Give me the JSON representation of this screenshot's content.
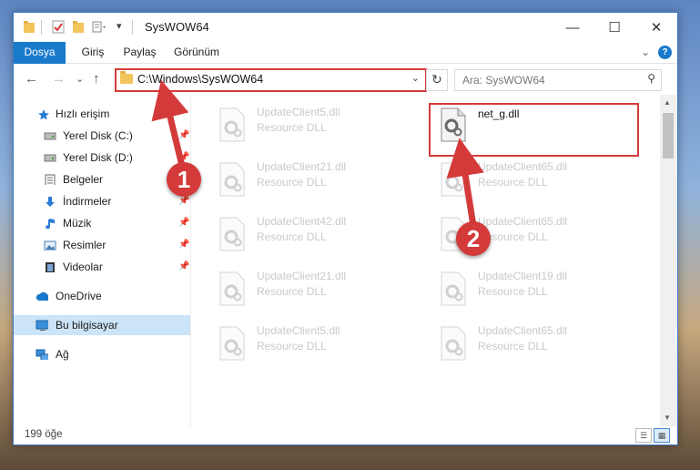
{
  "window": {
    "title": "SysWOW64",
    "controls": {
      "minimize": "—",
      "maximize": "☐",
      "close": "✕"
    }
  },
  "ribbon": {
    "tabs": [
      "Dosya",
      "Giriş",
      "Paylaş",
      "Görünüm"
    ],
    "expand_glyph": "⌄",
    "help_glyph": "?"
  },
  "navigation": {
    "back": "←",
    "forward": "→",
    "recent": "⌄",
    "up": "↑",
    "address_path": "C:\\Windows\\SysWOW64",
    "address_dropdown": "⌄",
    "refresh": "↻",
    "search_placeholder": "Ara: SysWOW64",
    "search_icon": "⚲"
  },
  "sidebar": {
    "items": [
      {
        "label": "Hızlı erişim",
        "icon": "star-icon",
        "pinned": false
      },
      {
        "label": "Yerel Disk (C:)",
        "icon": "drive-icon",
        "pinned": true
      },
      {
        "label": "Yerel Disk (D:)",
        "icon": "drive-icon",
        "pinned": true
      },
      {
        "label": "Belgeler",
        "icon": "documents-icon",
        "pinned": true
      },
      {
        "label": "İndirmeler",
        "icon": "download-icon",
        "pinned": true
      },
      {
        "label": "Müzik",
        "icon": "music-icon",
        "pinned": true
      },
      {
        "label": "Resimler",
        "icon": "pictures-icon",
        "pinned": true
      },
      {
        "label": "Videolar",
        "icon": "video-icon",
        "pinned": true
      },
      {
        "label": "OneDrive",
        "icon": "cloud-icon",
        "pinned": false
      },
      {
        "label": "Bu bilgisayar",
        "icon": "computer-icon",
        "pinned": false,
        "selected": true
      },
      {
        "label": "Ağ",
        "icon": "network-icon",
        "pinned": false
      }
    ]
  },
  "files": {
    "left_column": [
      {
        "name": "UpdateClient5.dll",
        "type": "Resource DLL"
      },
      {
        "name": "UpdateClient21.dll",
        "type": "Resource DLL"
      },
      {
        "name": "UpdateClient42.dll",
        "type": "Resource DLL"
      },
      {
        "name": "UpdateClient21.dll",
        "type": "Resource DLL"
      },
      {
        "name": "UpdateClient5.dll",
        "type": "Resource DLL"
      }
    ],
    "right_column": [
      {
        "name": "net_g.dll",
        "type": "",
        "target": true
      },
      {
        "name": "UpdateClient65.dll",
        "type": "Resource DLL"
      },
      {
        "name": "UpdateClient65.dll",
        "type": "Resource DLL"
      },
      {
        "name": "UpdateClient19.dll",
        "type": "Resource DLL"
      },
      {
        "name": "UpdateClient65.dll",
        "type": "Resource DLL"
      }
    ]
  },
  "status": {
    "item_count": "199 öğe"
  },
  "annotations": {
    "step1": "1",
    "step2": "2",
    "accent_color": "#d43a3a"
  }
}
